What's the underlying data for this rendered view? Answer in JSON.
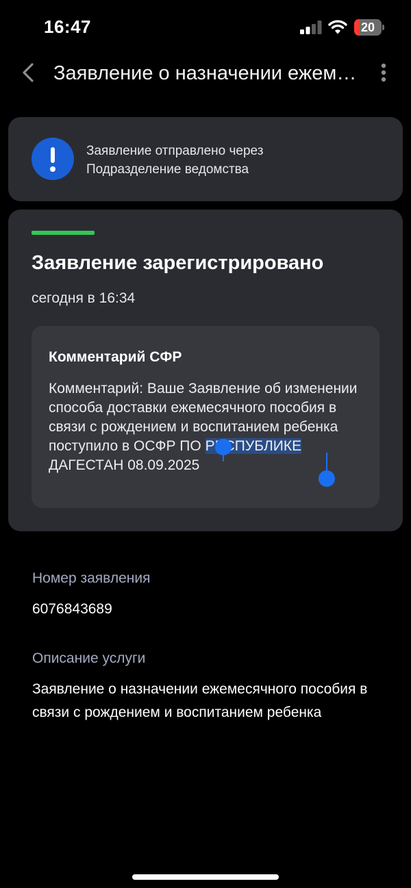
{
  "status_bar": {
    "time": "16:47",
    "battery_level": "20",
    "battery_fraction": 0.2,
    "signal_icon": "signal-bars-icon",
    "wifi_icon": "wifi-icon"
  },
  "nav": {
    "title": "Заявление о назначении ежемесячного пособия в связи с рождением и воспитанием ребенка",
    "back_icon": "chevron-left-icon",
    "more_icon": "more-vertical-icon"
  },
  "info_card": {
    "icon": "exclamation-circle-icon",
    "line1": "Заявление отправлено через",
    "line2": "Подразделение ведомства",
    "accent_color": "#1a5fd6"
  },
  "status_card": {
    "progress_color": "#34c759",
    "title": "Заявление зарегистрировано",
    "date": "сегодня в 16:34",
    "comment": {
      "title": "Комментарий СФР",
      "text_before": "Комментарий: Ваше Заявление об изменении способа доставки ежемесячного пособия в связи с рождением и воспитанием ребенка поступило в ОСФР ПО ",
      "text_selected": "РЕСПУБЛИКЕ",
      "text_after": " ДАГЕСТАН 08.09.2025"
    }
  },
  "details": {
    "number_label": "Номер заявления",
    "number_value": "6076843689",
    "service_label": "Описание услуги",
    "service_value": "Заявление о назначении ежемесячного пособия в связи с рождением и воспитанием ребенка"
  }
}
